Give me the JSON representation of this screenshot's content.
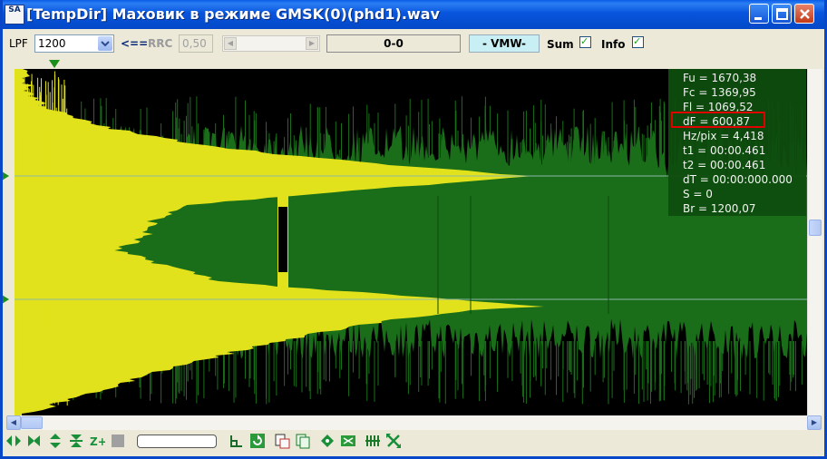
{
  "window": {
    "icon_text": "SA",
    "title": "[TempDir] Маховик в режиме GMSK(0)(phd1).wav"
  },
  "toolbar": {
    "lpf_label": "LPF",
    "lpf_value": "1200",
    "arrow_label": "<==",
    "rrc_label": "RRC",
    "rrc_value": "0,50",
    "position_readout": "0-0",
    "mode_readout": "- VMW-",
    "sum_label": "Sum",
    "sum_checked": true,
    "info_label": "Info",
    "info_checked": true
  },
  "info_panel": {
    "rows": [
      "Fu = 1670,38",
      "Fc = 1369,95",
      "Fl = 1069,52",
      "dF = 600,87",
      "Hz/pix = 4,418",
      "t1 = 00:00.461",
      "t2 = 00:00.461",
      "dT = 00:00:000.000",
      "S = 0",
      "Br = 1200,07"
    ],
    "highlighted_row": "dF = 600,87"
  },
  "colors": {
    "plot_background": "#000000",
    "spectrum_green": "#1a6e1a",
    "sum_yellow": "#e2e21c",
    "marker_line": "#8fb8a8",
    "highlight_box": "#e00000"
  },
  "bottom_toolbar": {
    "icons": [
      "scroll-left-right-icon",
      "scroll-right-stop-icon",
      "scroll-up-down-icon",
      "zoom-vertical-icon",
      "zoom-plus-icon",
      "stop-gray-icon",
      "step-icon",
      "refresh-icon",
      "copy-image-icon",
      "copy-icon",
      "diamond-icon",
      "fit-window-icon",
      "bars-icon",
      "cross-arrows-icon"
    ],
    "search_value": ""
  }
}
